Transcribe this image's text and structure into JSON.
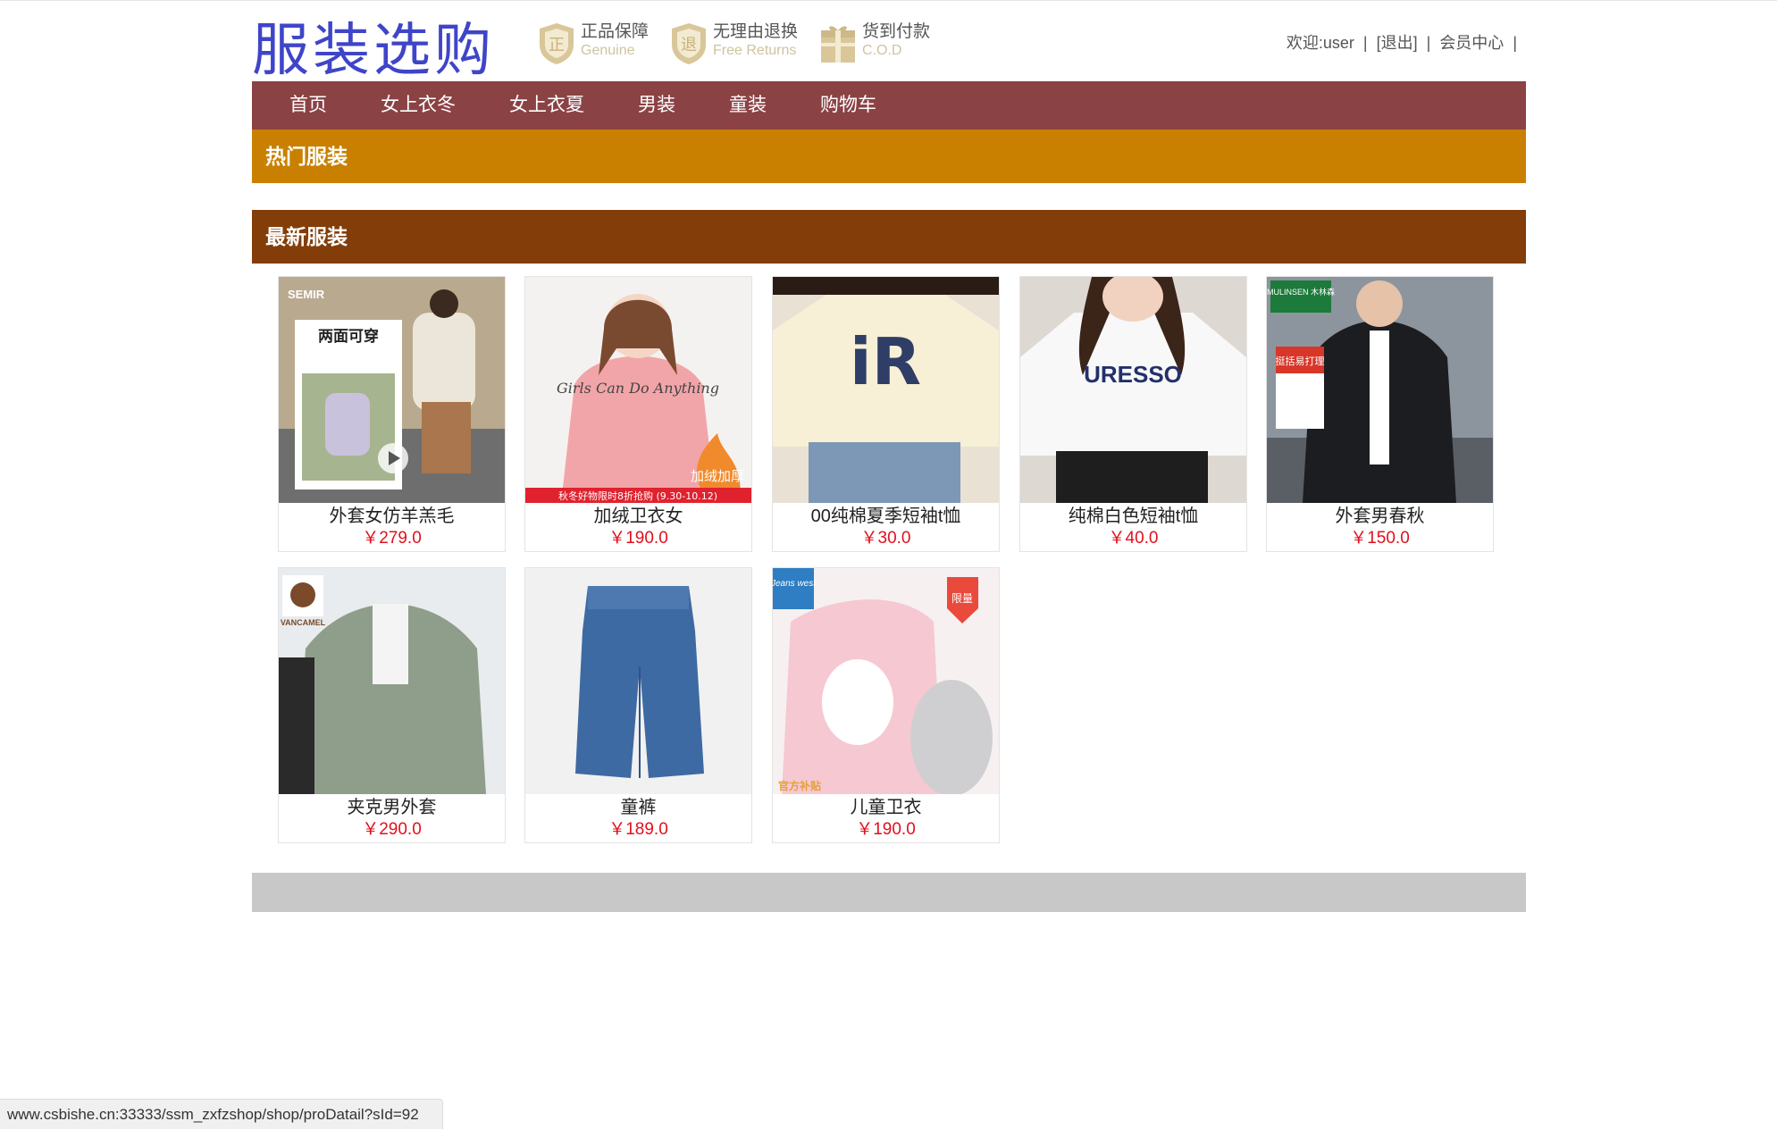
{
  "header": {
    "logo_text": "服装选购",
    "badges": [
      {
        "cn": "正品保障",
        "en": "Genuine",
        "icon": "genuine-shield-icon",
        "glyph": "正"
      },
      {
        "cn": "无理由退换",
        "en": "Free Returns",
        "icon": "returns-shield-icon",
        "glyph": "退"
      },
      {
        "cn": "货到付款",
        "en": "C.O.D",
        "icon": "cod-gift-icon",
        "glyph": "卅"
      }
    ],
    "user": {
      "welcome": "欢迎:user",
      "logout": "[退出]",
      "member_center": "会员中心",
      "separator": "|"
    }
  },
  "nav": {
    "items": [
      "首页",
      "女上衣冬",
      "女上衣夏",
      "男装",
      "童装",
      "购物车"
    ]
  },
  "sections": {
    "hot": "热门服装",
    "new": "最新服装"
  },
  "products": [
    {
      "name": "外套女仿羊羔毛",
      "price": "￥279.0"
    },
    {
      "name": "加绒卫衣女",
      "price": "￥190.0"
    },
    {
      "name": "00纯棉夏季短袖t恤",
      "price": "￥30.0"
    },
    {
      "name": "纯棉白色短袖t恤",
      "price": "￥40.0"
    },
    {
      "name": "外套男春秋",
      "price": "￥150.0"
    },
    {
      "name": "夹克男外套",
      "price": "￥290.0"
    },
    {
      "name": "童裤",
      "price": "￥189.0"
    },
    {
      "name": "儿童卫衣",
      "price": "￥190.0"
    }
  ],
  "thumb_text": {
    "p1_brand": "SEMIR",
    "p1_tag": "两面可穿",
    "p2_print": "Girls Can Do Anything",
    "p2_corner": "加绒加厚",
    "p2_banner": "秋冬好物限时8折抢购 (9.30-10.12)",
    "p3_logo": "iR",
    "p4_print": "URESSO",
    "p5_brand": "MULINSEN 木林森",
    "p5_tag": "挺括易打理",
    "p6_brand": "VANCAMEL",
    "p8_brand": "Jeans west",
    "p8_tag": "限量",
    "p8_bottom": "官方补贴"
  },
  "status_url": "www.csbishe.cn:33333/ssm_zxfzshop/shop/proDatail?sId=92"
}
